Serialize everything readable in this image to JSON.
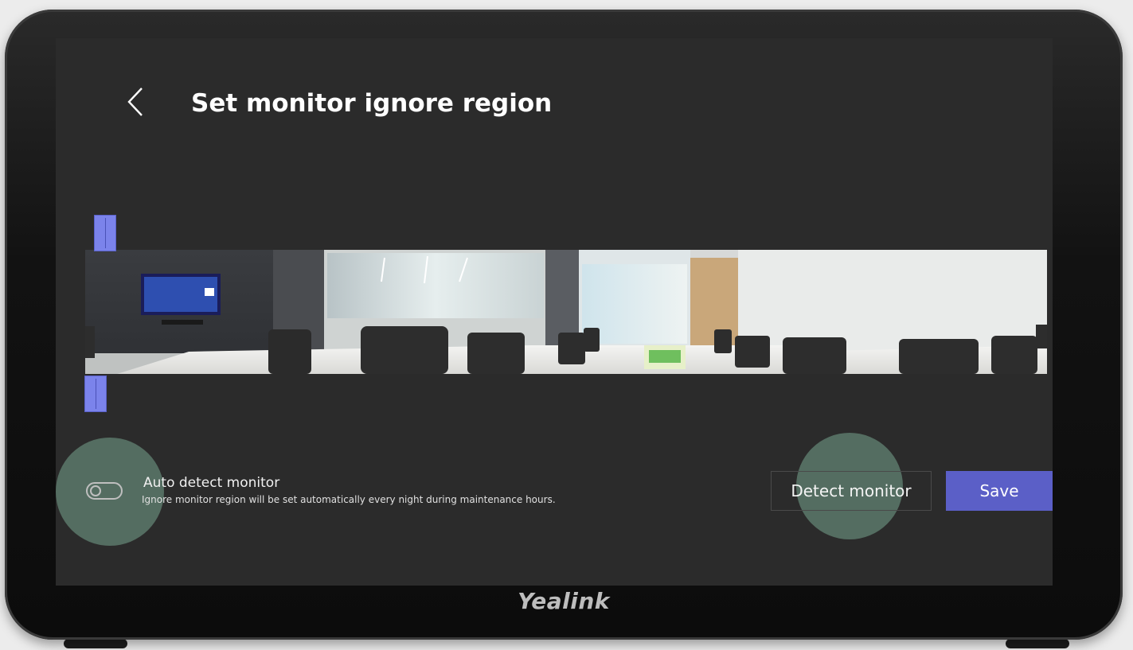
{
  "header": {
    "title": "Set monitor ignore region",
    "back_icon": "chevron-left-icon"
  },
  "auto_detect": {
    "label": "Auto detect monitor",
    "description": "Ignore monitor region will be set automatically every night during maintenance hours.",
    "enabled": false
  },
  "actions": {
    "detect_label": "Detect monitor",
    "save_label": "Save"
  },
  "device": {
    "brand": "Yealink"
  },
  "colors": {
    "accent": "#5b5fc7",
    "handle": "#7b83eb",
    "screen_bg": "#2b2b2b"
  }
}
